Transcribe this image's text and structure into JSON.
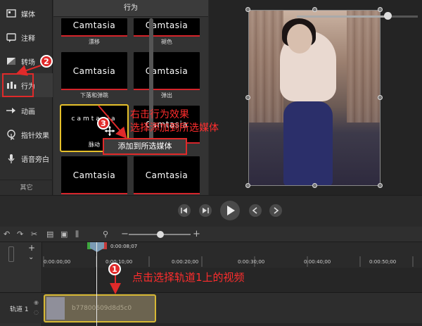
{
  "sidebar": {
    "items": [
      {
        "label": "媒体",
        "icon": "media-icon"
      },
      {
        "label": "注释",
        "icon": "annotation-icon"
      },
      {
        "label": "转场",
        "icon": "transition-icon"
      },
      {
        "label": "行为",
        "icon": "behavior-icon"
      },
      {
        "label": "动画",
        "icon": "animation-icon"
      },
      {
        "label": "指针效果",
        "icon": "cursor-effect-icon"
      },
      {
        "label": "语音旁白",
        "icon": "microphone-icon"
      }
    ],
    "more": "其它"
  },
  "panel": {
    "title": "行为",
    "tiles": [
      {
        "caption": "漂移",
        "text": "Camtasia"
      },
      {
        "caption": "褪色",
        "text": "Camtasia"
      },
      {
        "caption": "下落和弹跳",
        "text": "Camtasia"
      },
      {
        "caption": "弹出",
        "text": "Camtasia"
      },
      {
        "caption": "脉动",
        "text": "camtasia"
      },
      {
        "caption": "",
        "text": "Camtasia"
      },
      {
        "caption": "",
        "text": "Camtasia"
      },
      {
        "caption": "",
        "text": "Camtasia"
      }
    ]
  },
  "context_menu": {
    "item": "添加到所选媒体"
  },
  "timeline": {
    "time_readout": "0:00:08;07",
    "ticks": [
      "0:00:00;00",
      "0:00:10;00",
      "0:00:20;00",
      "0:00:30;00",
      "0:00:40;00",
      "0:00:50;00"
    ],
    "track_label": "轨道 1",
    "clip_name": "b77800609d8d5c0",
    "scrubber_progress": 0.75
  },
  "annotations": {
    "step1": "点击选择轨道1上的视频",
    "step3_line1": "右击行为效果",
    "step3_line2": "选择添加到所选媒体",
    "badge1": "1",
    "badge2": "2",
    "badge3": "3"
  },
  "colors": {
    "accent_red": "#e02a2a",
    "selection_yellow": "#e6c02a",
    "tile_bar": "#d4242a"
  }
}
